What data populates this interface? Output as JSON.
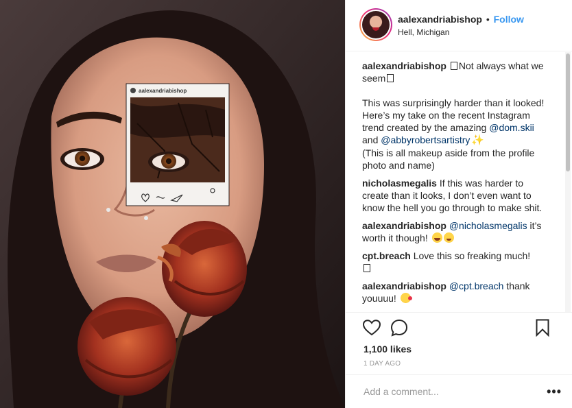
{
  "post": {
    "username": "aalexandriabishop",
    "follow_label": "Follow",
    "separator": "•",
    "location": "Hell, Michigan"
  },
  "photo_overlay": {
    "username": "aalexandriabishop"
  },
  "caption": {
    "username": "aalexandriabishop",
    "title_text": "Not always what we seem",
    "body_line1": "This was surprisingly harder than it looked! Here’s my take on the recent Instagram trend created by the amazing ",
    "mention1": "@dom.skii",
    "and_text": " and ",
    "mention2": "@abbyrobertsartistry",
    "body_line2": "(This is all makeup aside from the profile photo and name)"
  },
  "comments": [
    {
      "username": "nicholasmegalis",
      "mention": "",
      "text": "If this was harder to create than it looks, I don’t even want to know the hell you go through to make shit."
    },
    {
      "username": "aalexandriabishop",
      "mention": "@nicholasmegalis",
      "text": " it’s worth it though!"
    },
    {
      "username": "cpt.breach",
      "mention": "",
      "text": "Love this so freaking much!"
    },
    {
      "username": "aalexandriabishop",
      "mention": "@cpt.breach",
      "text": " thank youuuu!"
    }
  ],
  "likes": "1,100 likes",
  "timestamp": "1 DAY AGO",
  "add_comment": {
    "placeholder": "Add a comment..."
  },
  "more_label": "•••",
  "icons": {
    "like": "heart-icon",
    "comment": "comment-bubble-icon",
    "save": "bookmark-icon",
    "more": "more-options-icon"
  },
  "colors": {
    "accent": "#3897f0",
    "mention": "#003569",
    "muted": "#999999",
    "text": "#262626"
  }
}
